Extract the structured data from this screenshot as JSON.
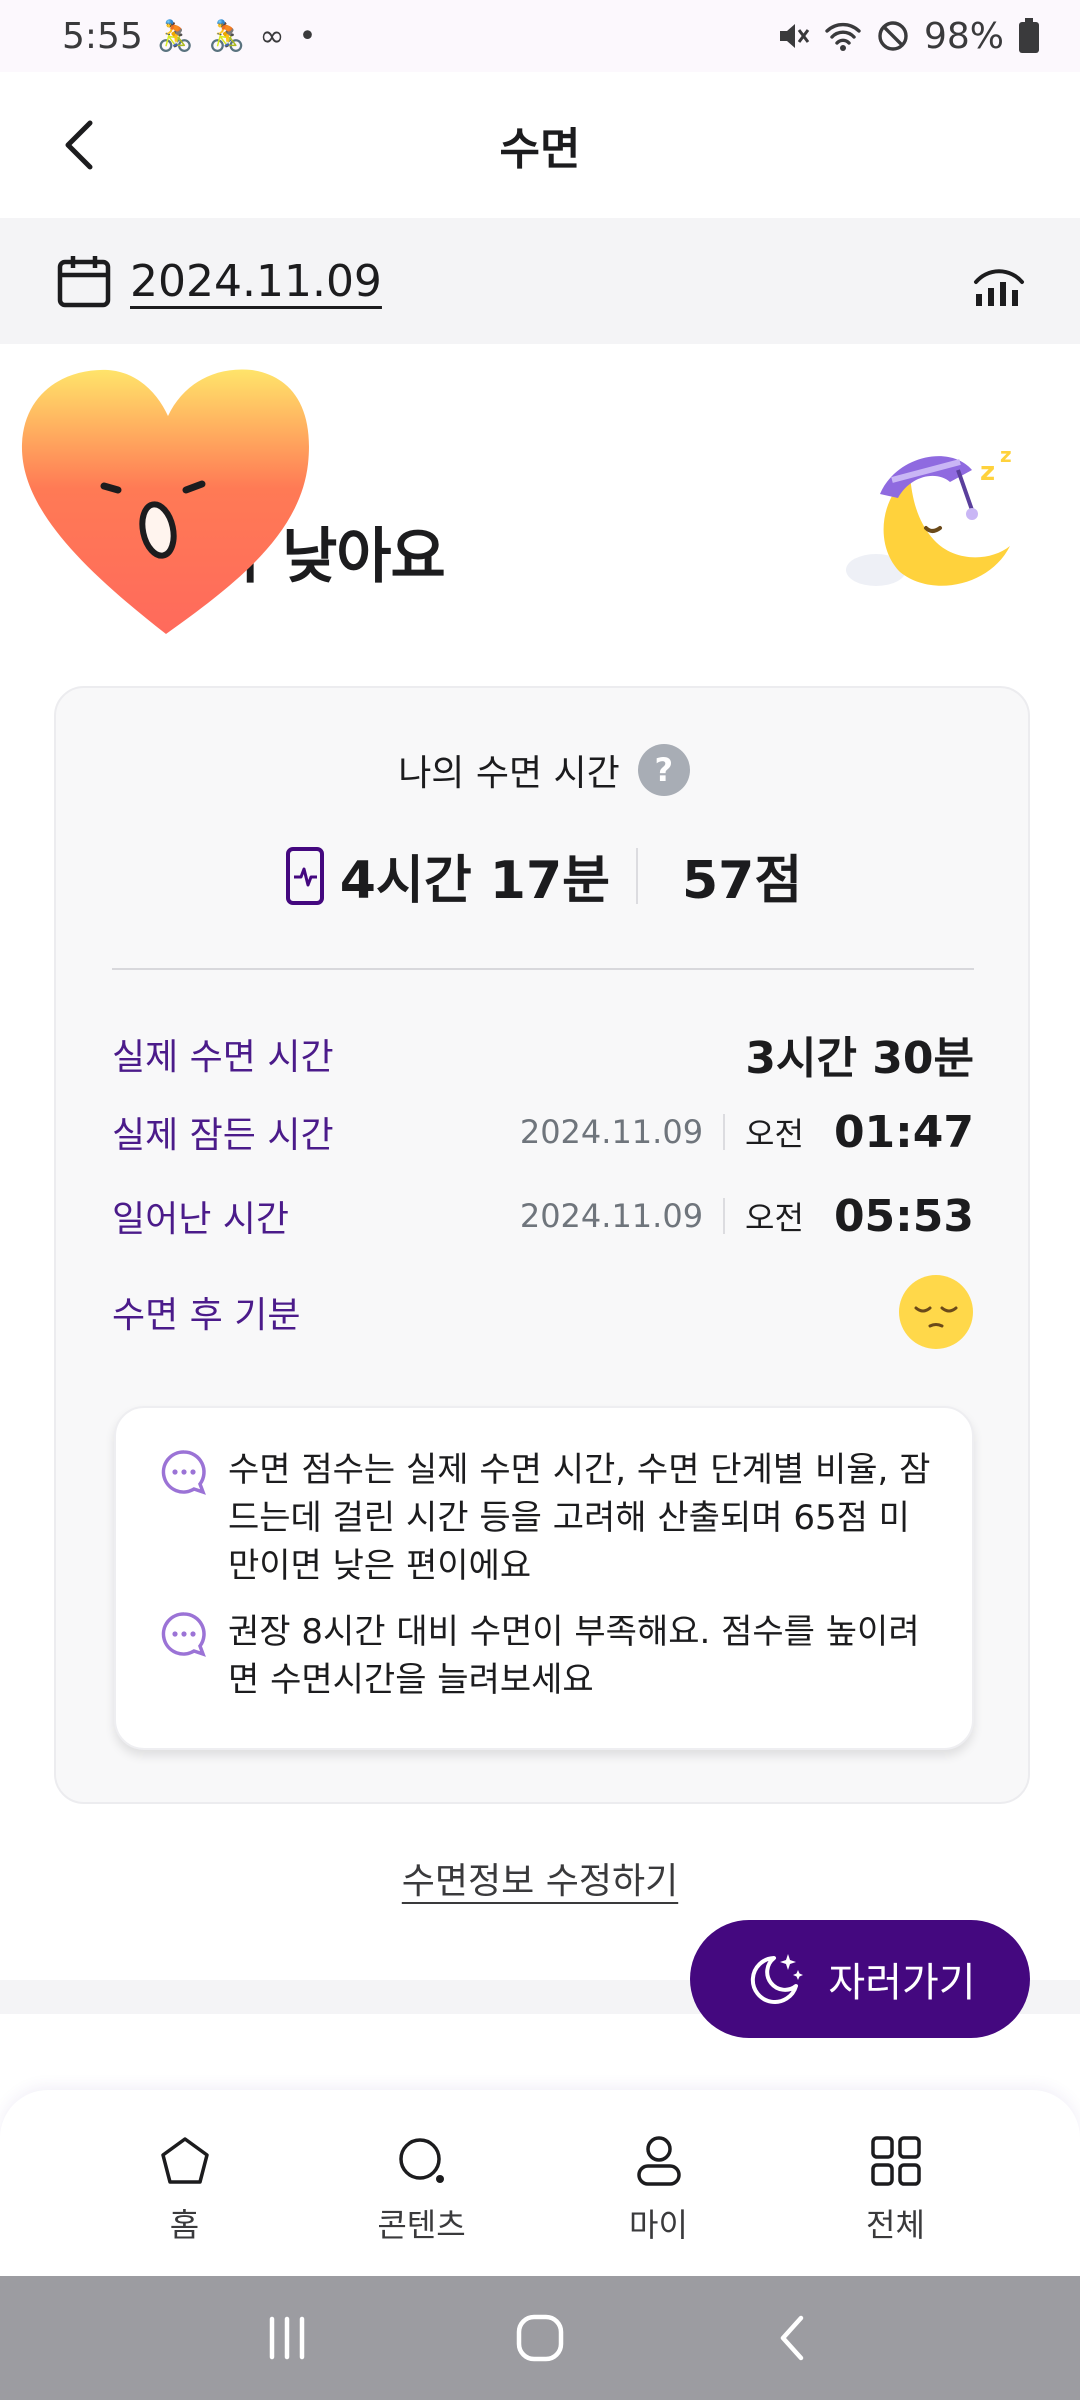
{
  "status_bar": {
    "time": "5:55",
    "battery": "98%",
    "left_icons": [
      "cycling-icon",
      "cycling-icon",
      "infinity-icon",
      "dot-icon"
    ],
    "right_icons": [
      "mute-icon",
      "wifi-icon",
      "blocked-icon",
      "battery-icon"
    ]
  },
  "app_bar": {
    "title": "수면"
  },
  "date_row": {
    "date": "2024.11.09"
  },
  "headline": {
    "text": "가 낮아요"
  },
  "summary": {
    "title": "나의 수면 시간",
    "help": "?",
    "total_time": "4시간 17분",
    "score": "57점"
  },
  "details": [
    {
      "label": "실제 수면 시간",
      "value": "3시간 30분"
    },
    {
      "label": "실제 잠든 시간",
      "date": "2024.11.09",
      "ampm": "오전",
      "time": "01:47"
    },
    {
      "label": "일어난 시간",
      "date": "2024.11.09",
      "ampm": "오전",
      "time": "05:53"
    },
    {
      "label": "수면 후 기분",
      "mood_icon": "sleepy-face-icon"
    }
  ],
  "tips": [
    "수면 점수는 실제 수면 시간, 수면 단계별 비율, 잠드는데 걸린 시간 등을 고려해 산출되며 65점 미만이면 낮은 편이에요",
    "권장 8시간 대비 수면이 부족해요. 점수를 높이려면 수면시간을 늘려보세요"
  ],
  "edit_link": "수면정보 수정하기",
  "fab": {
    "label": "자러가기",
    "icon": "moon-sparkle-icon"
  },
  "bottom_nav": [
    {
      "label": "홈",
      "icon": "home-icon"
    },
    {
      "label": "콘텐츠",
      "icon": "search-icon"
    },
    {
      "label": "마이",
      "icon": "person-icon"
    },
    {
      "label": "전체",
      "icon": "grid-icon"
    }
  ],
  "colors": {
    "accent": "#44087f",
    "label_purple": "#4b1b8a",
    "card_bg": "#f8f8f9",
    "system_nav": "#9c9ca1"
  }
}
